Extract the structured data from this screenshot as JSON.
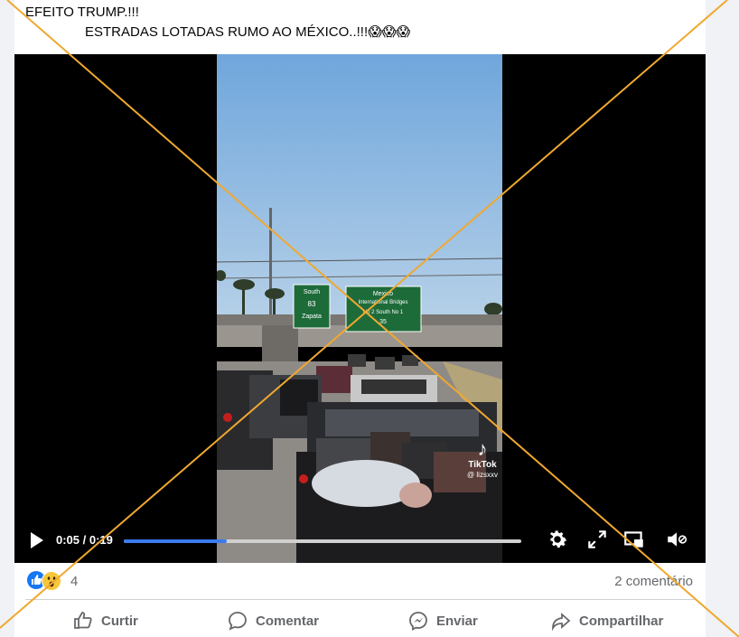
{
  "post": {
    "line1": "EFEITO TRUMP.!!!",
    "line2": "ESTRADAS LOTADAS RUMO AO MÉXICO..!!!😱😱😱"
  },
  "video": {
    "current_time": "0:05",
    "duration": "0:19",
    "time_display": "0:05 / 0:19",
    "progress_fraction": 0.26,
    "tiktok_brand": "TikTok",
    "tiktok_user": "@ lizsxxv",
    "sign_left": {
      "line1": "South",
      "route": "83",
      "line3": "Zapata"
    },
    "sign_right": {
      "line1": "Mexico",
      "line2": "International Bridges",
      "line3": "No 2  South  No 1",
      "route": "35"
    },
    "icons": [
      "play-icon",
      "settings-icon",
      "fullscreen-icon",
      "cast-icon",
      "volume-muted-icon"
    ]
  },
  "reactions": {
    "icons": [
      "like-icon",
      "wow-icon"
    ],
    "count": "4"
  },
  "comments_label": "2 comentário",
  "actions": {
    "like": "Curtir",
    "comment": "Comentar",
    "send": "Enviar",
    "share": "Compartilhar"
  },
  "colors": {
    "background": "#f0f2f5",
    "progress": "#3b7bf0",
    "cross_mark": "#f0a830",
    "secondary_text": "#65676b"
  }
}
